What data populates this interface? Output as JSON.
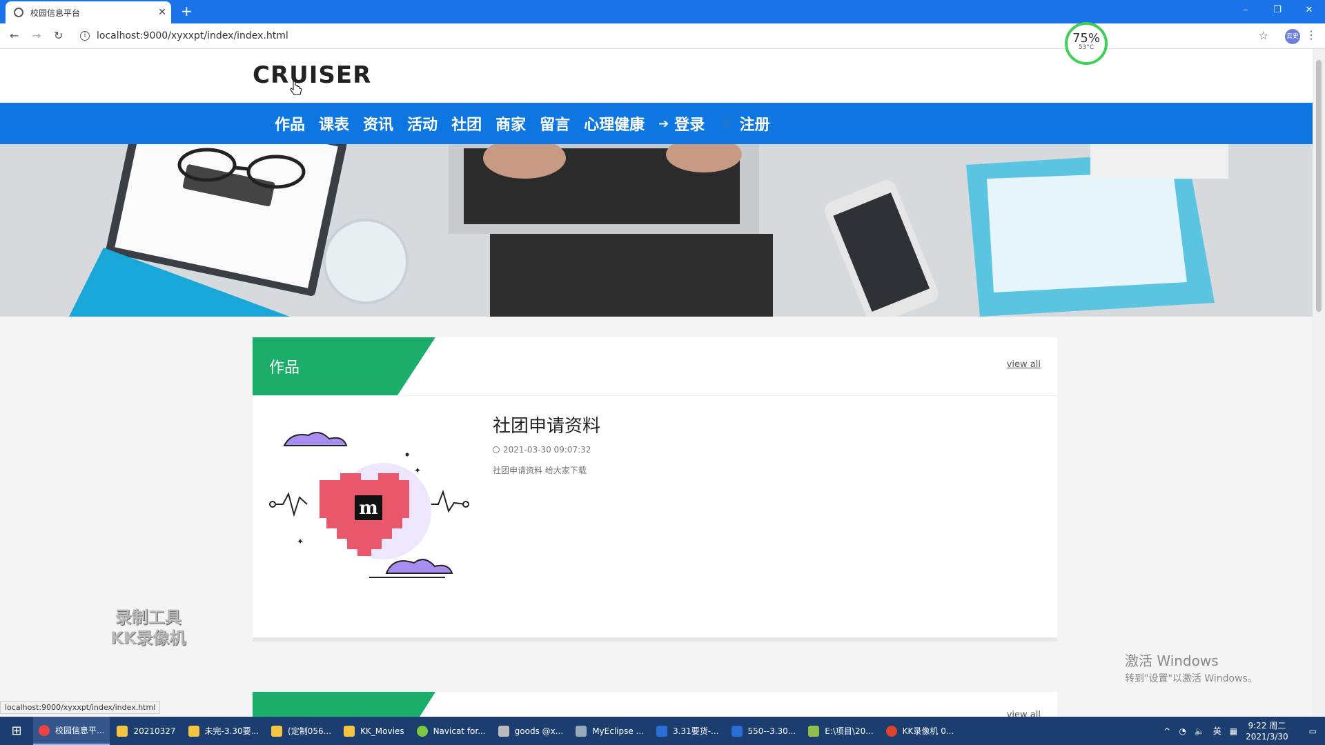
{
  "browser": {
    "tab_title": "校园信息平台",
    "tab_close": "✕",
    "new_tab": "+",
    "url": "localhost:9000/xyxxpt/index/index.html",
    "profile": "云史",
    "window_controls": [
      "–",
      "❐",
      "✕"
    ]
  },
  "perf_widget": {
    "percent": "75%",
    "temp": "53°C"
  },
  "site": {
    "logo": "CRUISER",
    "nav": [
      {
        "label": "作品"
      },
      {
        "label": "课表"
      },
      {
        "label": "资讯"
      },
      {
        "label": "活动"
      },
      {
        "label": "社团"
      },
      {
        "label": "商家"
      },
      {
        "label": "留言"
      },
      {
        "label": "心理健康"
      },
      {
        "label": "登录",
        "icon": "sign-in-icon"
      },
      {
        "label": "注册",
        "icon": "user-plus-icon"
      }
    ]
  },
  "section": {
    "title": "作品",
    "view_all": "view all",
    "item": {
      "title": "社团申请资料",
      "date": "2021-03-30 09:07:32",
      "desc": "社团申请资料 给大家下载",
      "image_letter": "m"
    }
  },
  "section2": {
    "view_all": "view all"
  },
  "status_bar_url": "localhost:9000/xyxxpt/index/index.html",
  "watermark": [
    "录制工具",
    "KK录像机"
  ],
  "activate_windows": {
    "line1": "激活 Windows",
    "line2": "转到\"设置\"以激活 Windows。"
  },
  "taskbar": {
    "items": [
      "校园信息平...",
      "20210327",
      "未完-3.30要...",
      "(定制056...",
      "KK_Movies",
      "Navicat for...",
      "goods @x...",
      "MyEclipse ...",
      "3.31要货-...",
      "550--3.30...",
      "E:\\项目\\20...",
      "KK录像机 0..."
    ],
    "tray_lang": "英",
    "time": "9:22 周二",
    "date": "2021/3/30"
  },
  "colors": {
    "nav_blue": "#0d76e0",
    "section_green": "#1aae6a",
    "tabbar_blue": "#1a73e8"
  }
}
